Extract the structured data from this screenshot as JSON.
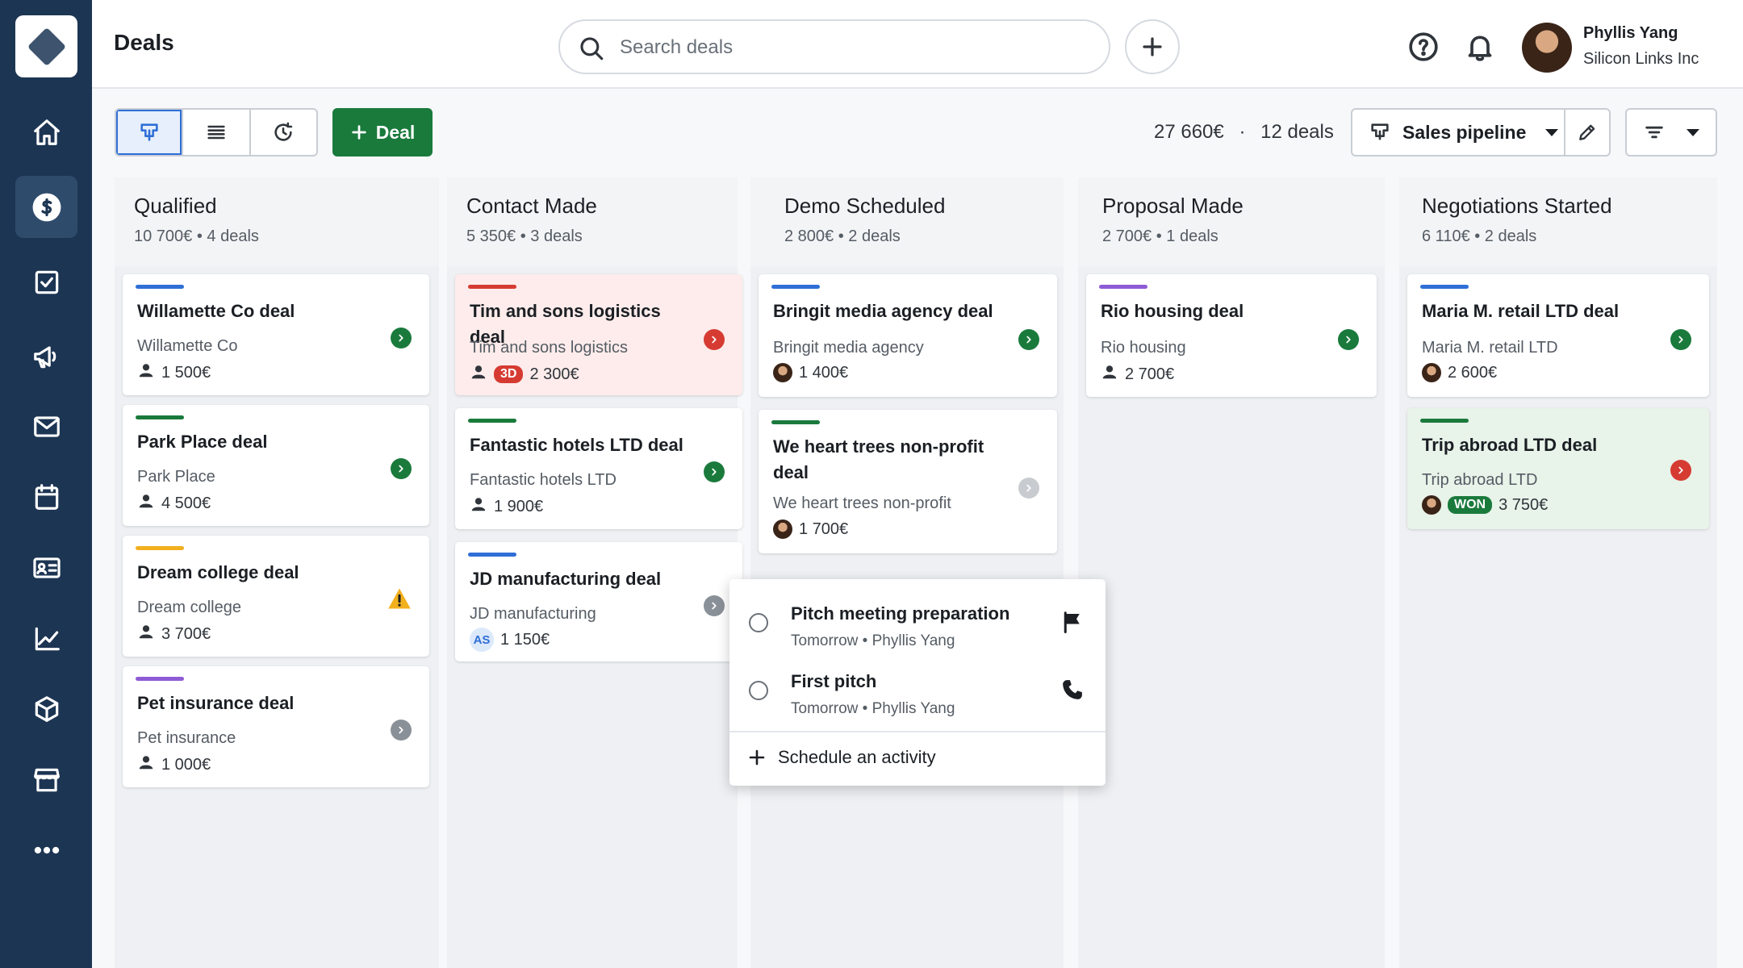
{
  "sidebar": {
    "items": [
      {
        "name": "home",
        "icon": "home-icon"
      },
      {
        "name": "deals",
        "icon": "dollar-icon"
      },
      {
        "name": "activities",
        "icon": "checkbox-icon"
      },
      {
        "name": "campaigns",
        "icon": "megaphone-icon"
      },
      {
        "name": "mail",
        "icon": "mail-icon"
      },
      {
        "name": "calendar",
        "icon": "calendar-icon"
      },
      {
        "name": "contacts",
        "icon": "contact-card-icon"
      },
      {
        "name": "insights",
        "icon": "chart-icon"
      },
      {
        "name": "products",
        "icon": "box-icon"
      },
      {
        "name": "marketplace",
        "icon": "store-icon"
      },
      {
        "name": "more",
        "icon": "more-icon"
      }
    ],
    "active": "deals"
  },
  "header": {
    "title": "Deals",
    "search_placeholder": "Search deals",
    "user_name": "Phyllis Yang",
    "user_company": "Silicon Links Inc"
  },
  "toolbar": {
    "deal_button": "Deal",
    "total_value": "27 660€",
    "separator": "·",
    "deal_count": "12 deals",
    "pipeline": "Sales pipeline"
  },
  "colors": {
    "sidebar": "#1c3553",
    "accent_green": "#1a7a3c",
    "accent_blue": "#2f6fd6",
    "alert_red": "#d63b32",
    "warning_yellow": "#f2b01e",
    "label_purple": "#8e5bd6"
  },
  "columns": [
    {
      "title": "Qualified",
      "summary": "10 700€  •  4 deals",
      "cards": [
        {
          "title": "Willamette Co deal",
          "org": "Willamette Co",
          "value": "1 500€",
          "label_color": "#2f6fd6",
          "status": "green"
        },
        {
          "title": "Park Place deal",
          "org": "Park Place",
          "value": "4 500€",
          "label_color": "#1a7a3c",
          "status": "green"
        },
        {
          "title": "Dream college deal",
          "org": "Dream college",
          "value": "3 700€",
          "label_color": "#f2b01e",
          "status": "warning"
        },
        {
          "title": "Pet insurance deal",
          "org": "Pet insurance",
          "value": "1 000€",
          "label_color": "#8e5bd6",
          "status": "grey"
        }
      ]
    },
    {
      "title": "Contact Made",
      "summary": "5 350€  •  3 deals",
      "cards": [
        {
          "title": "Tim and sons logistics deal",
          "org": "Tim and sons logistics",
          "value": "2 300€",
          "tag": "3D",
          "label_color": "#d63b32",
          "status": "red"
        },
        {
          "title": "Fantastic hotels LTD deal",
          "org": "Fantastic hotels LTD",
          "value": "1 900€",
          "label_color": "#1a7a3c",
          "status": "green"
        },
        {
          "title": "JD manufacturing deal",
          "org": "JD manufacturing",
          "value": "1 150€",
          "owner_initials": "AS",
          "label_color": "#2f6fd6",
          "status": "grey"
        }
      ]
    },
    {
      "title": "Demo Scheduled",
      "summary": "2 800€  •  2 deals",
      "cards": [
        {
          "title": "Bringit media agency deal",
          "org": "Bringit media agency",
          "value": "1 400€",
          "label_color": "#2f6fd6",
          "status": "green"
        },
        {
          "title": "We heart trees non-profit deal",
          "org": "We heart trees non-profit",
          "value": "1 700€",
          "label_color": "#1a7a3c",
          "status": "lightgrey"
        }
      ]
    },
    {
      "title": "Proposal Made",
      "summary": "2 700€  •  1 deals",
      "cards": [
        {
          "title": "Rio housing deal",
          "org": "Rio housing",
          "value": "2 700€",
          "label_color": "#8e5bd6",
          "status": "green"
        }
      ]
    },
    {
      "title": "Negotiations Started",
      "summary": "6 110€  •  2 deals",
      "cards": [
        {
          "title": "Maria M. retail LTD deal",
          "org": "Maria M. retail LTD",
          "value": "2 600€",
          "label_color": "#2f6fd6",
          "status": "green"
        },
        {
          "title": "Trip abroad LTD deal",
          "org": "Trip abroad LTD",
          "value": "3 750€",
          "tag": "WON",
          "label_color": "#1a7a3c",
          "status": "red"
        }
      ]
    }
  ],
  "activity_popup": {
    "activities": [
      {
        "name": "Pitch meeting preparation",
        "when": "Tomorrow  •  Phyllis Yang",
        "icon": "flag-icon"
      },
      {
        "name": "First pitch",
        "when": "Tomorrow  •  Phyllis Yang",
        "icon": "phone-icon"
      }
    ],
    "schedule_label": "Schedule an activity"
  }
}
